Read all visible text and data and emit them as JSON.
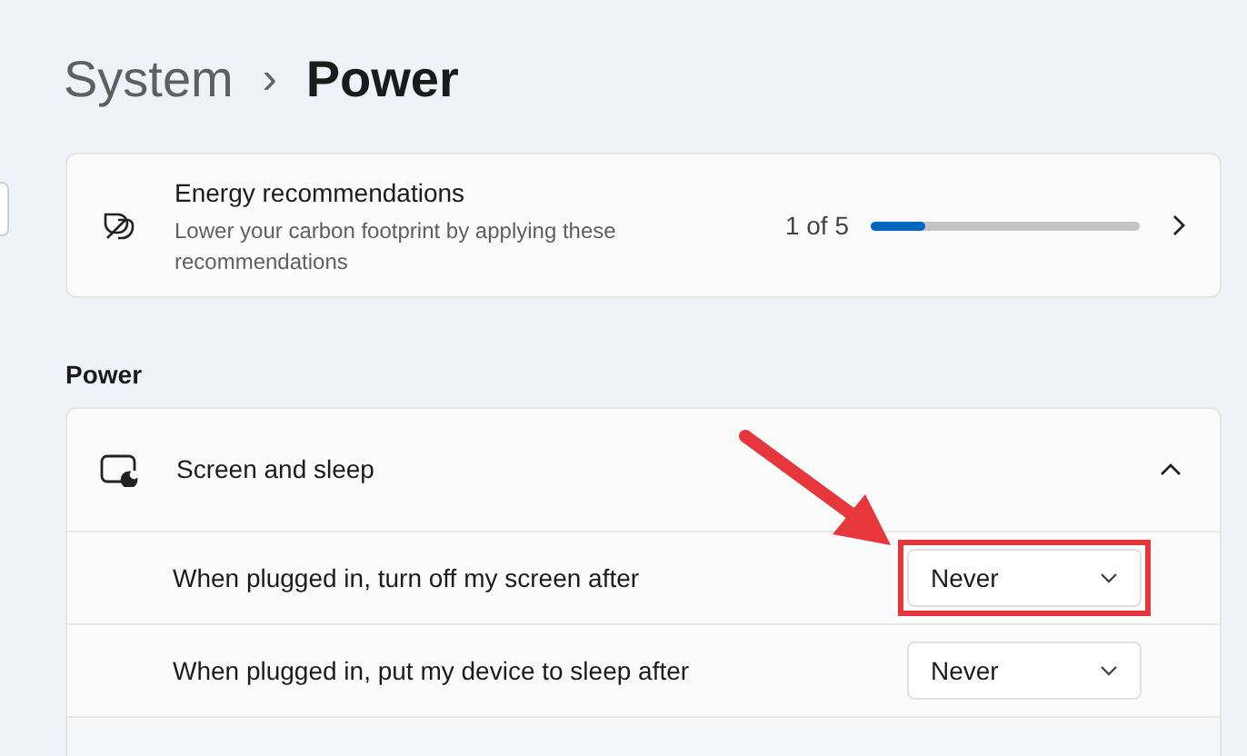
{
  "breadcrumb": {
    "parent": "System",
    "separator": "›",
    "current": "Power"
  },
  "recommendations": {
    "title": "Energy recommendations",
    "description": "Lower your carbon footprint by applying these recommendations",
    "progress_text": "1 of 5",
    "level": 0.2
  },
  "section_title": "Power",
  "screen_and_sleep": {
    "title": "Screen and sleep",
    "expanded": true,
    "rows": [
      {
        "label": "When plugged in, turn off my screen after",
        "value": "Never",
        "highlighted": true
      },
      {
        "label": "When plugged in, put my device to sleep after",
        "value": "Never",
        "highlighted": false
      }
    ]
  }
}
